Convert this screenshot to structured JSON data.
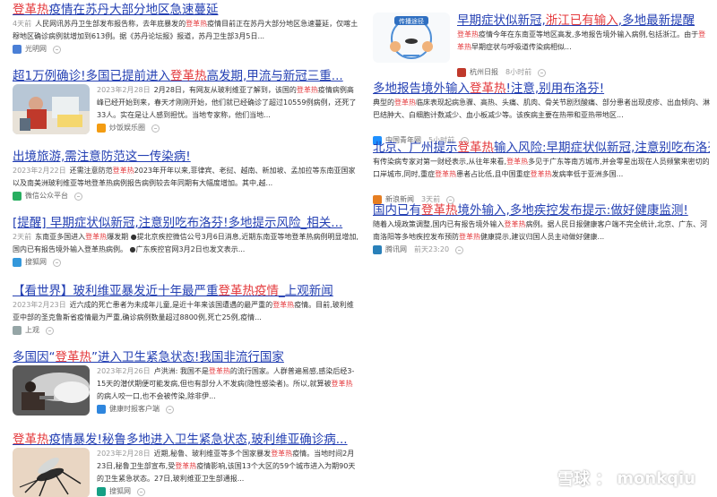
{
  "left": [
    {
      "title_parts": [
        {
          "t": "登革热",
          "hl": true
        },
        {
          "t": "疫情在苏丹大部分地区急速蔓延",
          "hl": false
        }
      ],
      "desc_date": "4天前",
      "desc_parts": [
        {
          "t": "人民网讯苏丹卫生部发布报告称，去年底暴发的",
          "hl": false
        },
        {
          "t": "登革热",
          "hl": true
        },
        {
          "t": "疫情目前正在苏丹大部分地区急速蔓延，仅喀土穆地区确诊病例就增加到613例。据《苏丹论坛报》报道，苏丹卫生部3月5日...",
          "hl": false
        }
      ],
      "source": "光明网",
      "time": ""
    },
    {
      "title_parts": [
        {
          "t": "超1万例确诊!多国已提前进入",
          "hl": false
        },
        {
          "t": "登革热",
          "hl": true
        },
        {
          "t": "高发期,甲流与新冠三重...",
          "hl": false
        }
      ],
      "desc_date": "2023年2月28日",
      "desc_parts": [
        {
          "t": "2月28日，有网友从玻利维亚了解到，该国的",
          "hl": false
        },
        {
          "t": "登革热",
          "hl": true
        },
        {
          "t": "疫情病例高峰已经开始到来，春天才刚刚开始，他们就已经确诊了超过10559例病例，还死了33人。实在是让人感到担忧。当地专家称，他们当地...",
          "hl": false
        }
      ],
      "source": "炒饭娱乐圈",
      "time": ""
    },
    {
      "title_parts": [
        {
          "t": "出境旅游,需注意防范这一传染病!",
          "hl": false
        }
      ],
      "desc_date": "2023年2月22日",
      "desc_parts": [
        {
          "t": "还需注意防范",
          "hl": false
        },
        {
          "t": "登革热",
          "hl": true
        },
        {
          "t": "2023年开年以来,菲律宾、老挝、越南、新加坡、孟加拉等东南亚国家以及南美洲玻利维亚等地登革热病例报告病例较去年同期有大幅度增加。其中,越...",
          "hl": false
        }
      ],
      "source": "微信公众平台",
      "time": ""
    },
    {
      "title_parts": [
        {
          "t": "[提醒] 早期症状似新冠,注意别吃布洛芬!多地提示风险_相关...",
          "hl": false
        }
      ],
      "desc_date": "2天前",
      "desc_parts": [
        {
          "t": "东南亚多国进入",
          "hl": false
        },
        {
          "t": "登革热",
          "hl": true
        },
        {
          "t": "爆发期 ●提北京疾控微信公号3月6日消息,近期东南亚等地登革热病例明显增加,国内已有报告境外输入登革热病例。 ●广东疾控官网3月2日也发文表示...",
          "hl": false
        }
      ],
      "source": "搜狐网",
      "time": ""
    },
    {
      "title_parts": [
        {
          "t": "【看世界】玻利维亚暴发近十年最严重",
          "hl": false
        },
        {
          "t": "登革热疫情",
          "hl": true
        },
        {
          "t": "_上观新闻",
          "hl": false
        }
      ],
      "desc_date": "2023年2月23日",
      "desc_parts": [
        {
          "t": "近六成的死亡患者为未成年儿童,是近十年来该国遭遇的最严重的",
          "hl": false
        },
        {
          "t": "登革热",
          "hl": true
        },
        {
          "t": "疫情。目前,玻利维亚中部的圣克鲁斯省疫情最为严重,确诊病例数量超过8800例,死亡25例,疫情...",
          "hl": false
        }
      ],
      "source": "上观",
      "time": ""
    },
    {
      "title_parts": [
        {
          "t": "多国因“",
          "hl": false
        },
        {
          "t": "登革热",
          "hl": true
        },
        {
          "t": "”进入卫生紧急状态!我国非流行国家",
          "hl": false
        }
      ],
      "desc_date": "2023年2月26日",
      "desc_parts": [
        {
          "t": "卢洪洲: 我国不是",
          "hl": false
        },
        {
          "t": "登革热",
          "hl": true
        },
        {
          "t": "的流行国家。人群普遍易感,感染后经3-15天的潜伏期便可能发病,但也有部分人不发病(隐性感染者)。所以,就算被",
          "hl": false
        },
        {
          "t": "登革热",
          "hl": true
        },
        {
          "t": "的病人咬一口,也不会被传染,除非伊...",
          "hl": false
        }
      ],
      "source": "健康时报客户端",
      "time": ""
    },
    {
      "title_parts": [
        {
          "t": "登革热",
          "hl": true
        },
        {
          "t": "疫情暴发!秘鲁多地进入卫生紧急状态,玻利维亚确诊病...",
          "hl": false
        }
      ],
      "desc_date": "2023年2月28日",
      "desc_parts": [
        {
          "t": "近期,秘鲁、玻利维亚等多个国家暴发",
          "hl": false
        },
        {
          "t": "登革热",
          "hl": true
        },
        {
          "t": "疫情。当地时间2月23日,秘鲁卫生部宣布,受",
          "hl": false
        },
        {
          "t": "登革热",
          "hl": true
        },
        {
          "t": "疫情影响,该国13个大区的59个城市进入为期90天的卫生紧急状态。27日,玻利维亚卫生部通报...",
          "hl": false
        }
      ],
      "source": "搜狐网",
      "time": ""
    }
  ],
  "right": [
    {
      "title_parts": [
        {
          "t": "早期症状似新冠,",
          "hl": false
        },
        {
          "t": "浙江已有输入",
          "hl": true
        },
        {
          "t": ",多地最新提醒",
          "hl": false
        }
      ],
      "desc_date": "",
      "desc_parts": [
        {
          "t": "",
          "hl": false
        },
        {
          "t": "登革热",
          "hl": true
        },
        {
          "t": "疫情今年在东南亚等地区高发,多地报告境外输入病例,包括浙江。由于",
          "hl": false
        },
        {
          "t": "登革热",
          "hl": true
        },
        {
          "t": "早期症状与呼吸道传染病相似...",
          "hl": false
        }
      ],
      "source": "杭州日报",
      "time": "8小时前",
      "thumb_text": "传播途径"
    },
    {
      "title_parts": [
        {
          "t": "多地报告境外输入",
          "hl": false
        },
        {
          "t": "登革热",
          "hl": true
        },
        {
          "t": "!注意,别用布洛芬!",
          "hl": false
        }
      ],
      "desc_date": "",
      "desc_parts": [
        {
          "t": "典型的",
          "hl": false
        },
        {
          "t": "登革热",
          "hl": true
        },
        {
          "t": "临床表现起病急骤、高热、头痛、肌肉、骨关节剧烈酸痛、部分患者出现皮疹、出血倾向、淋巴结肿大、白细胞计数减少、血小板减少等。该疾病主要在热带和亚热带地区...",
          "hl": false
        }
      ],
      "source": "中国青年网",
      "time": "5小时前"
    },
    {
      "title_parts": [
        {
          "t": "北京、广州提示",
          "hl": false
        },
        {
          "t": "登革热",
          "hl": true
        },
        {
          "t": "输入风险:早期症状似新冠,注意别吃布洛芬!",
          "hl": false
        }
      ],
      "desc_date": "",
      "desc_parts": [
        {
          "t": "有传染病专家对第一财经表示,从往年来看,",
          "hl": false
        },
        {
          "t": "登革热",
          "hl": true
        },
        {
          "t": "多见于广东等南方城市,并会零星出现在人员频繁来密切的口岸城市,同时,重症",
          "hl": false
        },
        {
          "t": "登革热",
          "hl": true
        },
        {
          "t": "患者占比低,且中国重症",
          "hl": false
        },
        {
          "t": "登革热",
          "hl": true
        },
        {
          "t": "发病率低于亚洲多国...",
          "hl": false
        }
      ],
      "source": "新浪新闻",
      "time": "3天前"
    },
    {
      "title_parts": [
        {
          "t": "国内已有",
          "hl": false
        },
        {
          "t": "登革热",
          "hl": true
        },
        {
          "t": "境外输入,多地疾控发布提示:做好健康监测!",
          "hl": false
        }
      ],
      "desc_date": "",
      "desc_parts": [
        {
          "t": "随着入境政策调整,国内已有报告境外输入",
          "hl": false
        },
        {
          "t": "登革热",
          "hl": true
        },
        {
          "t": "病例。据人民日报健康客户端不完全统计,北京、广东、河南洛阳等多地疾控发布预防",
          "hl": false
        },
        {
          "t": "登革热",
          "hl": true
        },
        {
          "t": "健康提示,建议归国人员主动做好健康...",
          "hl": false
        }
      ],
      "source": "腾讯网",
      "time": "前天23:20"
    }
  ],
  "watermark": {
    "brand": "雪球",
    "sep": "：",
    "user": "monkqiu"
  }
}
